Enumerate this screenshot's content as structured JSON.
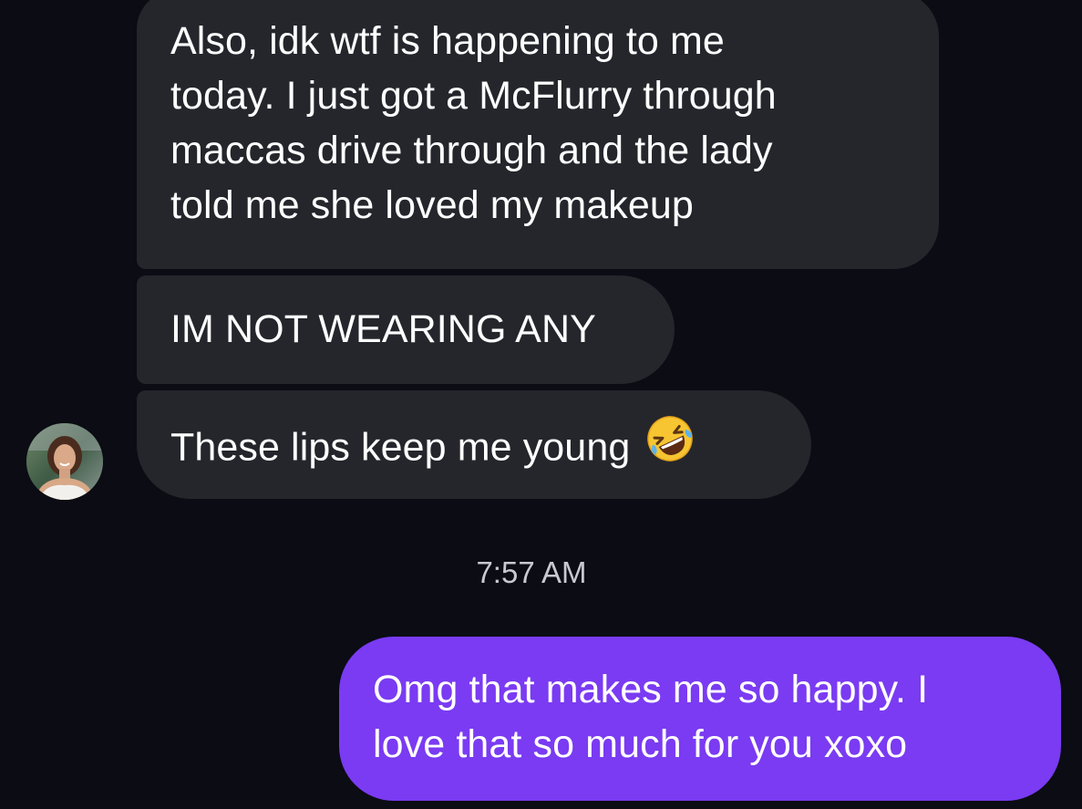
{
  "conversation": {
    "incoming": [
      {
        "lines": [
          "Also, idk wtf is happening to me",
          "today. I just got a McFlurry through",
          "maccas drive through and the lady",
          "told me she loved my makeup"
        ]
      },
      {
        "text": "IM NOT WEARING ANY"
      },
      {
        "text": "These lips keep me young",
        "emoji": "rolling-on-the-floor-laughing"
      }
    ],
    "timestamp": "7:57 AM",
    "outgoing": [
      {
        "lines": [
          "Omg that makes me so happy. I",
          "love that so much for you xoxo"
        ]
      }
    ]
  },
  "colors": {
    "background": "#0b0c14",
    "incoming_bubble": "#25262c",
    "outgoing_bubble": "#7a3bf2",
    "timestamp": "#c8c9d0"
  },
  "icons": {
    "avatar": "contact-avatar-photo",
    "emoji": "rolling-on-the-floor-laughing-emoji"
  }
}
